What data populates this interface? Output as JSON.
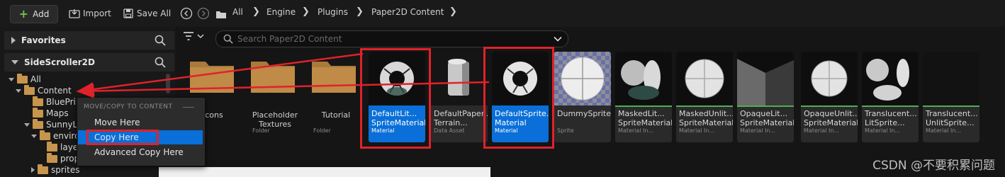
{
  "toolbar": {
    "add_label": "Add",
    "import_label": "Import",
    "save_all_label": "Save All"
  },
  "breadcrumb": [
    "All",
    "Engine",
    "Plugins",
    "Paper2D Content"
  ],
  "sidebar": {
    "favorites_label": "Favorites",
    "project_label": "SideScroller2D",
    "tree": {
      "all": "All",
      "content": "Content",
      "blueprints": "BluePrin",
      "maps": "Maps",
      "sunny": "SunnyL",
      "environment": "enviro",
      "layers": "laye",
      "props": "prop",
      "sprites": "sprites"
    }
  },
  "search": {
    "placeholder": "Search Paper2D Content"
  },
  "context_menu": {
    "header": "MOVE/COPY TO CONTENT",
    "items": [
      "Move Here",
      "Copy Here",
      "Advanced Copy Here"
    ]
  },
  "assets": [
    {
      "name": "Icons",
      "type": ""
    },
    {
      "name": "Placeholder Textures",
      "type": "Folder"
    },
    {
      "name": "Tutorial",
      "type": "Folder"
    },
    {
      "name": "DefaultLit... SpriteMaterial",
      "type": "Material"
    },
    {
      "name": "DefaultPaper... Terrain...",
      "type": "Data Asset"
    },
    {
      "name": "DefaultSprite... Material",
      "type": "Material"
    },
    {
      "name": "DummySprite",
      "type": "Sprite"
    },
    {
      "name": "MaskedLit... SpriteMaterial",
      "type": "Material In..."
    },
    {
      "name": "MaskedUnlit... SpriteMaterial",
      "type": "Material In..."
    },
    {
      "name": "OpaqueLit... SpriteMaterial",
      "type": "Material In..."
    },
    {
      "name": "OpaqueUnlit... SpriteMaterial",
      "type": "Material In..."
    },
    {
      "name": "Translucent... LitSprite...",
      "type": "Material In..."
    },
    {
      "name": "Translucent... UnlitSprite...",
      "type": "Material In..."
    }
  ],
  "watermark": "CSDN @不要积累问题",
  "colors": {
    "selection": "#0a6fd8",
    "annotation_red": "#e0222a",
    "folder": "#c8954c",
    "add_plus": "#6ec24b"
  }
}
